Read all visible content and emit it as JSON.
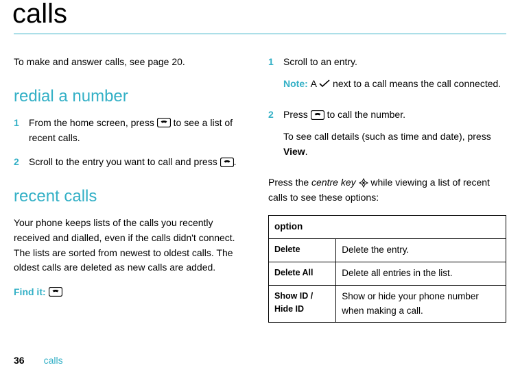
{
  "title": "calls",
  "intro": "To make and answer calls, see page 20.",
  "section_redial": "redial a number",
  "redial_steps": [
    {
      "num": "1",
      "pre": "From the home screen, press ",
      "post": " to see a list of recent calls."
    },
    {
      "num": "2",
      "pre": "Scroll to the entry you want to call and press ",
      "post": "."
    }
  ],
  "section_recent": "recent calls",
  "recent_para": "Your phone keeps lists of the calls you recently received and dialled, even if the calls didn't connect. The lists are sorted from newest to oldest calls. The oldest calls are deleted as new calls are added.",
  "find_it": "Find it: ",
  "right_steps": [
    {
      "num": "1",
      "text": "Scroll to an entry."
    },
    {
      "num": "2",
      "pre": "Press ",
      "post": " to call the number."
    }
  ],
  "note_label": "Note: ",
  "note_pre": "A ",
  "note_post": " next to a call means the call connected.",
  "see_details_pre": "To see call details (such as time and date), press ",
  "see_details_key": "View",
  "see_details_post": ".",
  "press_centre_pre": "Press the ",
  "press_centre_key": "centre key",
  "press_centre_post": " while viewing a list of recent calls to see these options:",
  "table": {
    "header": "option",
    "rows": [
      {
        "name": "Delete",
        "desc": "Delete the entry."
      },
      {
        "name": "Delete All",
        "desc": "Delete all entries in the list."
      },
      {
        "name": "Show ID / Hide ID",
        "desc": "Show or hide your phone number when making a call."
      }
    ]
  },
  "footer": {
    "page": "36",
    "section": "calls"
  }
}
